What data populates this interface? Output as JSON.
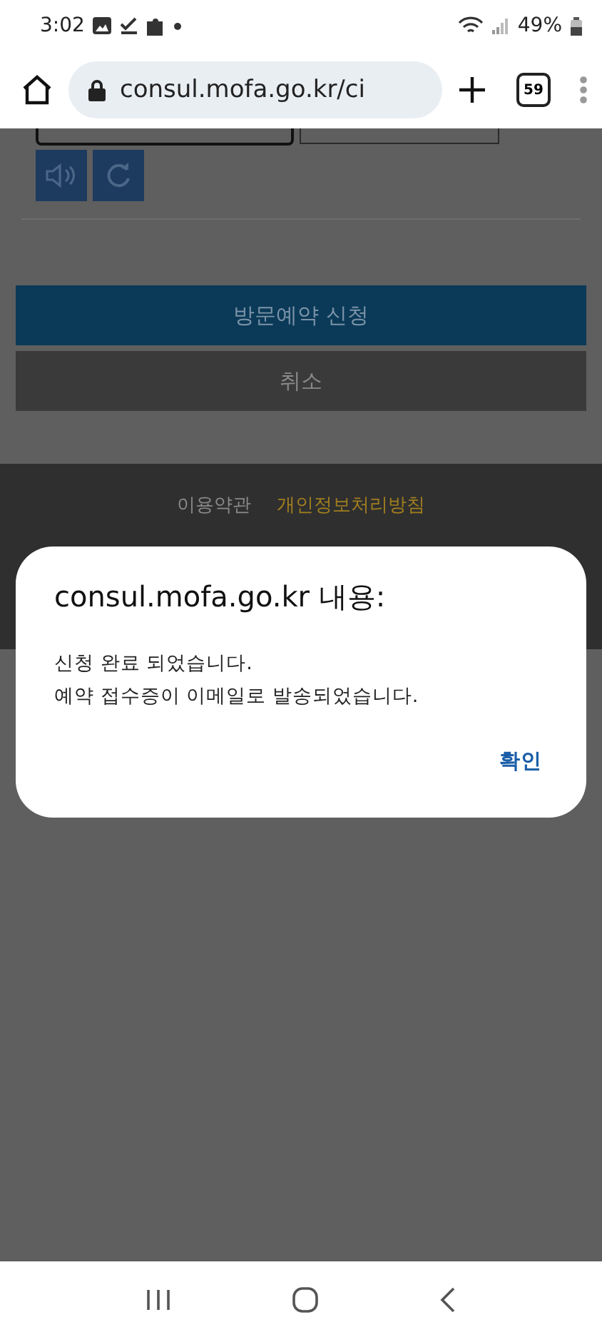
{
  "status_bar": {
    "time": "3:02",
    "battery": "49%"
  },
  "browser": {
    "url": "consul.mofa.go.kr/ci",
    "tab_count": "59"
  },
  "page": {
    "fields": [
      {
        "kind": "field",
        "focused": true
      },
      {
        "kind": "field",
        "focused": false
      }
    ],
    "submit_button": "방문예약 신청",
    "cancel_button": "취소",
    "footer_links": [
      {
        "label": "이용약관",
        "highlighted": false
      },
      {
        "label": "개인정보처리방침",
        "highlighted": true
      }
    ]
  },
  "dialog": {
    "title": "consul.mofa.go.kr 내용:",
    "message": [
      "신청 완료 되었습니다.",
      "예약 접수증이 이메일로 발송되었습니다."
    ],
    "button": "확인"
  }
}
